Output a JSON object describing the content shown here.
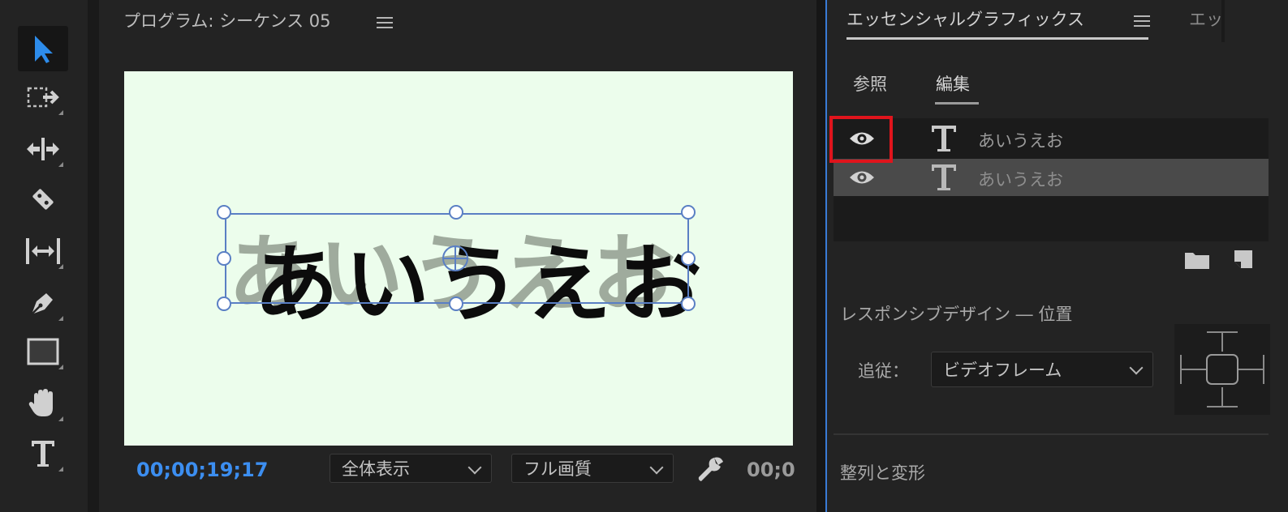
{
  "toolbar": {
    "tools": [
      {
        "name": "selection-tool",
        "icon": "arrow-icon",
        "active": true
      },
      {
        "name": "track-select-tool",
        "icon": "track-select-icon"
      },
      {
        "name": "ripple-edit-tool",
        "icon": "ripple-edit-icon"
      },
      {
        "name": "razor-tool",
        "icon": "razor-icon"
      },
      {
        "name": "slip-tool",
        "icon": "slip-icon"
      },
      {
        "name": "pen-tool",
        "icon": "pen-icon"
      },
      {
        "name": "rectangle-tool",
        "icon": "rectangle-icon"
      },
      {
        "name": "hand-tool",
        "icon": "hand-icon"
      },
      {
        "name": "type-tool",
        "icon": "type-icon"
      }
    ],
    "accent": "#2d8ceb"
  },
  "monitor": {
    "title": "プログラム: シーケンス 05",
    "canvas_text": "あいうえお",
    "shadow_text": "あいうえお",
    "canvas_bg": "#ecfdec",
    "timecode": "00;00;19;17",
    "zoom": "全体表示",
    "quality": "フル画質",
    "timecode_right": "00;0"
  },
  "panel": {
    "tab": "エッセンシャルグラフィックス",
    "tab2": "エッ",
    "subtabs": {
      "browse": "参照",
      "edit": "編集"
    },
    "layers": [
      {
        "name": "あいうえお",
        "selected": false
      },
      {
        "name": "あいうえお",
        "selected": true
      }
    ],
    "responsive_title": "レスポンシブデザイン ― 位置",
    "follow_label": "追従：",
    "follow_value": "ビデオフレーム",
    "align_title": "整列と変形",
    "highlight_color": "#e0141c"
  }
}
